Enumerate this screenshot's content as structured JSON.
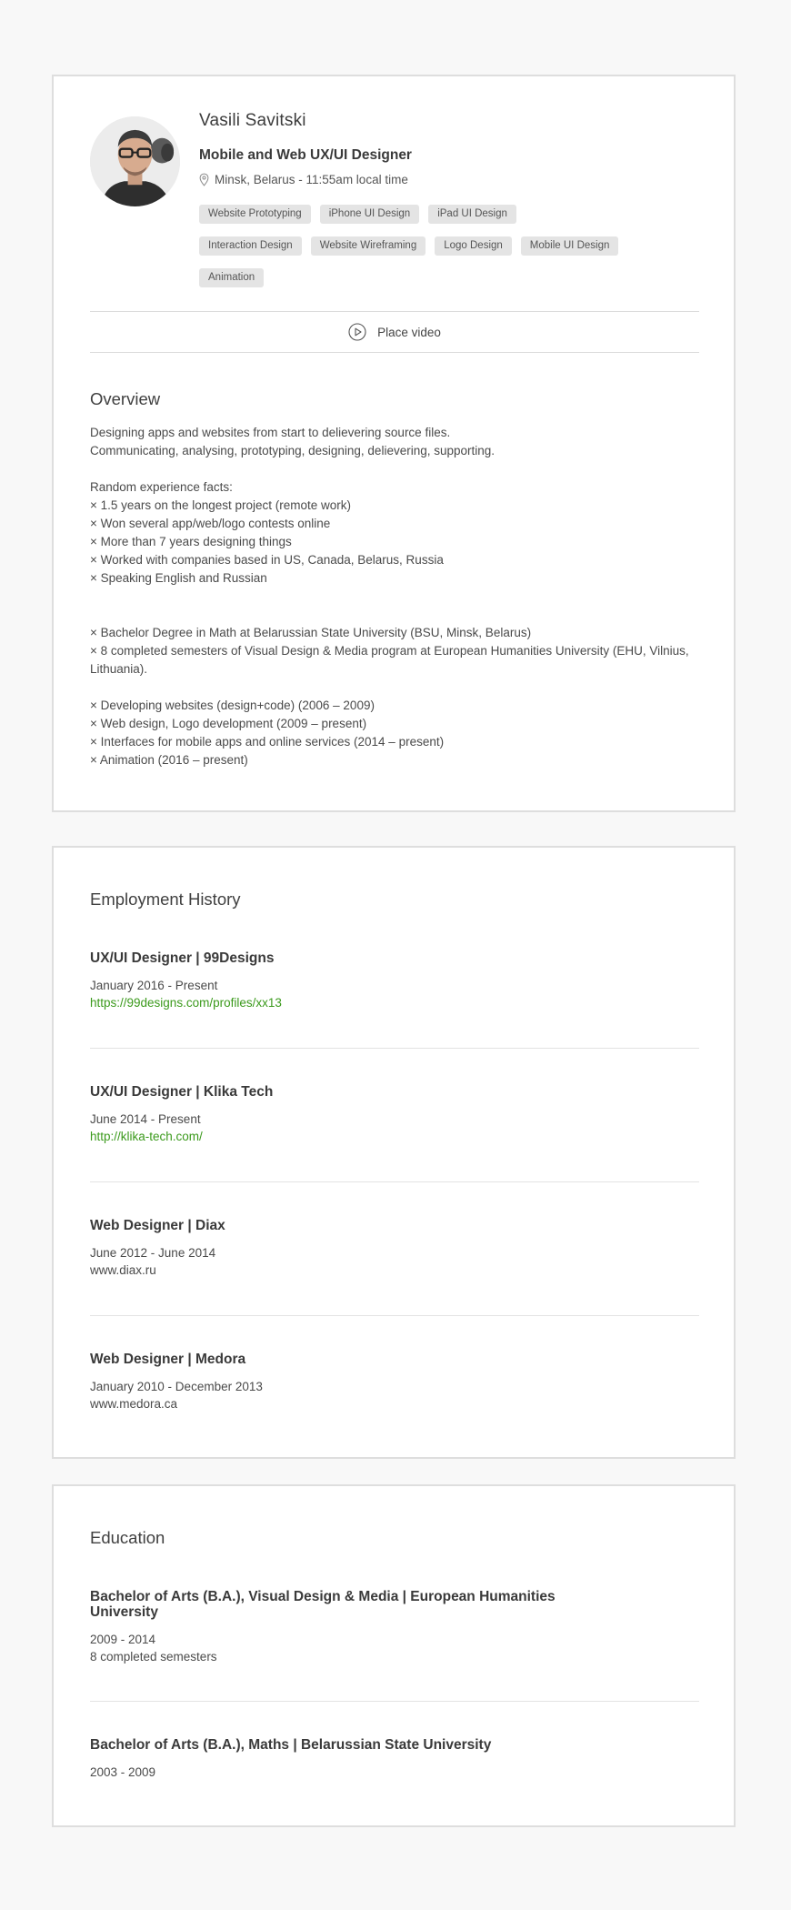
{
  "profile": {
    "name": "Vasili Savitski",
    "title": "Mobile and Web UX/UI Designer",
    "location": "Minsk, Belarus - 11:55am local time",
    "skills": [
      "Website Prototyping",
      "iPhone UI Design",
      "iPad UI Design",
      "Interaction Design",
      "Website Wireframing",
      "Logo Design",
      "Mobile UI Design",
      "Animation"
    ],
    "video_label": "Place video",
    "icons": {
      "location": "map-pin-icon",
      "video": "play-circle-icon"
    }
  },
  "overview": {
    "heading": "Overview",
    "intro": [
      "Designing apps and websites from start to delievering source files.",
      "Communicating, analysing, prototyping, designing, delievering, supporting."
    ],
    "facts_heading": "Random experience facts:",
    "facts": [
      "× 1.5 years on the longest project (remote work)",
      "× Won several app/web/logo contests online",
      "× More than 7 years designing things",
      "× Worked with companies based in US, Canada, Belarus, Russia",
      "× Speaking English and Russian"
    ],
    "education_facts": [
      "× Bachelor Degree in Math at Belarussian State University (BSU, Minsk, Belarus)",
      "× 8 completed semesters of Visual Design & Media program at European Humanities University (EHU, Vilnius, Lithuania)."
    ],
    "career_facts": [
      "× Developing websites (design+code) (2006 – 2009)",
      "× Web design, Logo development (2009 – present)",
      "× Interfaces for mobile apps and online services (2014 – present)",
      "× Animation (2016 – present)"
    ]
  },
  "employment": {
    "heading": "Employment History",
    "jobs": [
      {
        "title": "UX/UI Designer | 99Designs",
        "dates": "January 2016 - Present",
        "link": "https://99designs.com/profiles/xx13"
      },
      {
        "title": "UX/UI Designer | Klika Tech",
        "dates": "June 2014 - Present",
        "link": "http://klika-tech.com/"
      },
      {
        "title": "Web Designer | Diax",
        "dates": "June 2012 - June 2014",
        "link": "www.diax.ru"
      },
      {
        "title": "Web Designer | Medora",
        "dates": "January 2010 - December 2013",
        "link": "www.medora.ca"
      }
    ]
  },
  "education": {
    "heading": "Education",
    "items": [
      {
        "title": "Bachelor of Arts (B.A.), Visual Design & Media | European Humanities University",
        "dates": "2009 - 2014",
        "note": "8 completed semesters"
      },
      {
        "title": "Bachelor of Arts (B.A.), Maths | Belarussian State University",
        "dates": "2003 - 2009"
      }
    ]
  },
  "colors": {
    "page_background": "#f8f8f8",
    "card_border": "#dedede",
    "link_green": "#3b9a1c",
    "tag_background": "#e4e4e4"
  }
}
